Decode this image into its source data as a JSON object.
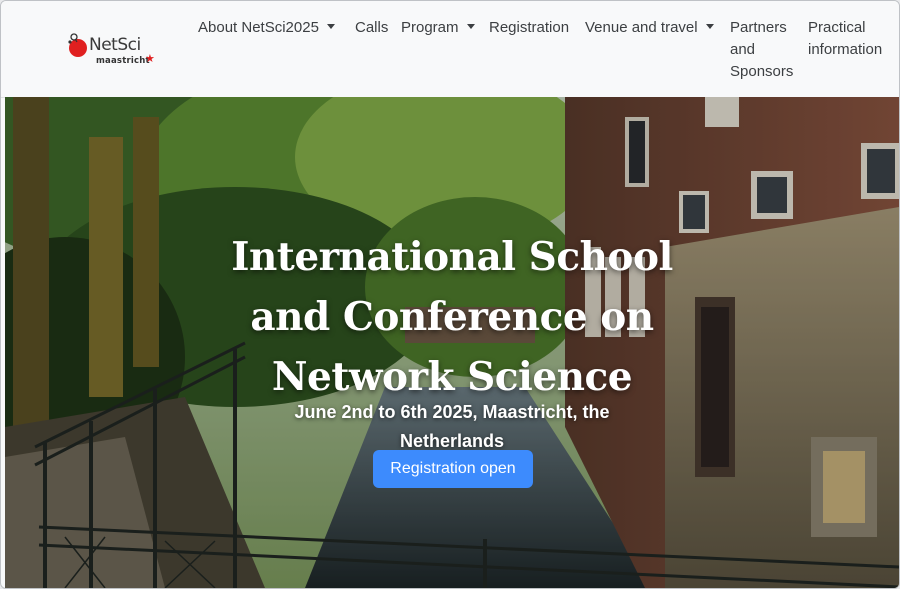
{
  "site": {
    "logo_word": "NetSci",
    "logo_sub": "maastricht",
    "logo_star": "★"
  },
  "nav": {
    "items": [
      {
        "label": "About NetSci2025",
        "dropdown": true
      },
      {
        "label": "Calls",
        "dropdown": false
      },
      {
        "label": "Program",
        "dropdown": true
      },
      {
        "label": "Registration",
        "dropdown": false
      },
      {
        "label": "Venue and travel",
        "dropdown": true
      },
      {
        "label": "Partners and Sponsors",
        "dropdown": false
      },
      {
        "label": "Practical information",
        "dropdown": false
      }
    ]
  },
  "hero": {
    "title": "International School and Conference on Network Science",
    "subtitle": "June 2nd to 6th 2025, Maastricht, the Netherlands",
    "cta_label": "Registration open"
  },
  "colors": {
    "accent": "#3d8bfd",
    "logo_red": "#e02020",
    "nav_text": "#3c3f42",
    "navbar_bg": "#f8f9fa"
  }
}
